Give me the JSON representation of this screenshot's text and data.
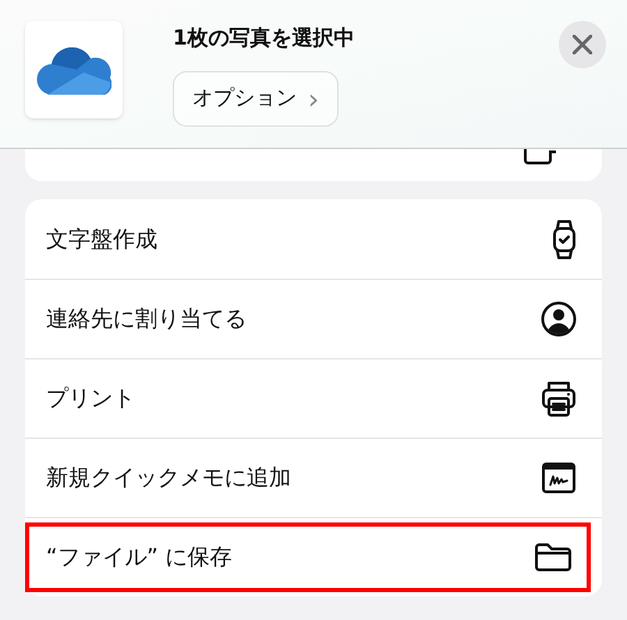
{
  "header": {
    "title": "1枚の写真を選択中",
    "options_button": "オプション",
    "options_chevron": "›"
  },
  "actions": [
    {
      "label": "文字盤作成",
      "kind": "watch",
      "highlighted": false
    },
    {
      "label": "連絡先に割り当てる",
      "kind": "contact",
      "highlighted": false
    },
    {
      "label": "プリント",
      "kind": "printer",
      "highlighted": false
    },
    {
      "label": "新規クイックメモに追加",
      "kind": "memo",
      "highlighted": false
    },
    {
      "label": "“ファイル” に保存",
      "kind": "folder",
      "highlighted": true
    }
  ]
}
